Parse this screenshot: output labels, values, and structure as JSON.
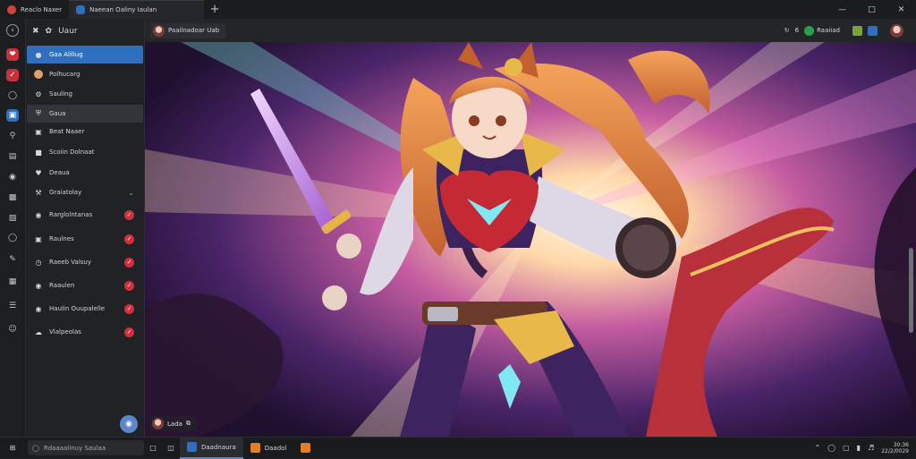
{
  "colors": {
    "accent": "#2f6fbd",
    "badge": "#d12f3b",
    "online": "#22a34b"
  },
  "tabs": [
    {
      "label": "Reaclo Naxer",
      "icon": "app-icon-red"
    },
    {
      "label": "Naeean Oaliny Iaulan",
      "icon": "app-icon-blue"
    }
  ],
  "sidebar": {
    "header": "Uaur",
    "items": [
      {
        "label": "Gaa Aliliug",
        "icon": "gallery-icon",
        "selected": true
      },
      {
        "label": "Polhucarg",
        "icon": "avatar-icon"
      },
      {
        "label": "Sauling",
        "icon": "settings-icon"
      },
      {
        "label": "Gaua",
        "icon": "shield-icon"
      },
      {
        "label": "Beat Naaer",
        "icon": "note-icon"
      },
      {
        "label": "Scoiin Dolnaat",
        "icon": "lock-icon"
      },
      {
        "label": "Deaua",
        "icon": "heart-icon"
      },
      {
        "label": "Graiatolay",
        "icon": "tools-icon",
        "chevron": true
      },
      {
        "label": "Rarglolntanas",
        "icon": "globe-icon",
        "check": true
      },
      {
        "label": "Raulnes",
        "icon": "cube-icon",
        "check": true
      },
      {
        "label": "Raeeb Valsuy",
        "icon": "clock-icon",
        "check": true
      },
      {
        "label": "Raaulen",
        "icon": "shield-icon",
        "check": true
      },
      {
        "label": "Haulin Ouupalelle",
        "icon": "people-icon",
        "check": true
      },
      {
        "label": "Vlalpeolas",
        "icon": "cloud-icon",
        "check": true
      }
    ]
  },
  "toolbar": {
    "user": "Paailnadoar Uab",
    "count": "6",
    "status": "Raaiiad"
  },
  "canvas": {
    "caption": "Lada"
  },
  "taskbar": {
    "search_placeholder": "Rdaaaalinuy Saulaa",
    "apps": [
      {
        "label": "Daadnaura",
        "icon": "app-icon-blue",
        "active": true
      },
      {
        "label": "Daadol",
        "icon": "app-icon-orange",
        "active": false
      }
    ],
    "clock": {
      "time": "30:36",
      "date": "22/2/0029"
    }
  }
}
